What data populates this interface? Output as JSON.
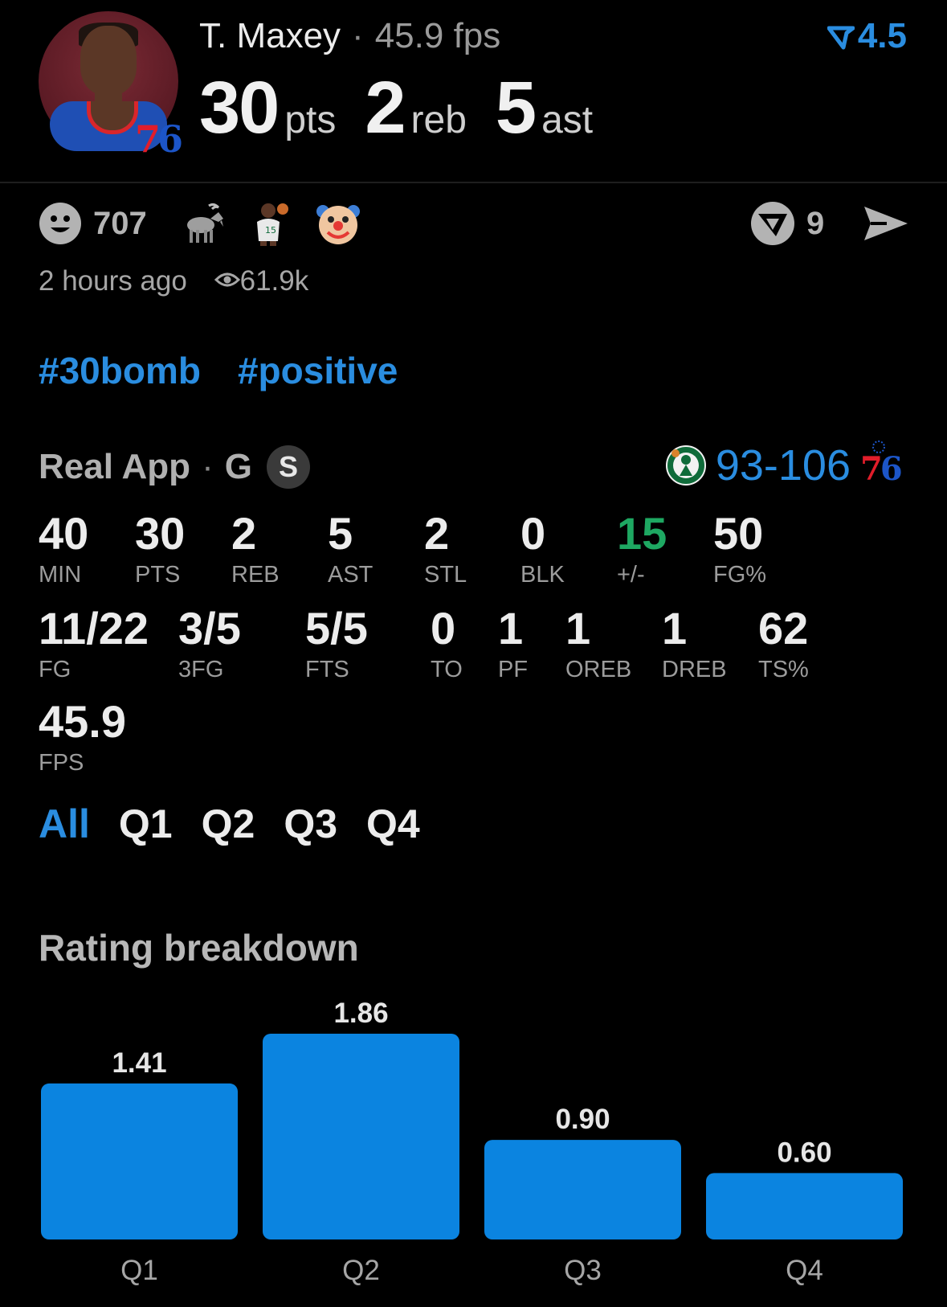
{
  "header": {
    "player_name": "T. Maxey",
    "fps_text": "45.9 fps",
    "line_value": "4.5",
    "team_logo_text": "76",
    "pts_value": "30",
    "pts_unit": "pts",
    "reb_value": "2",
    "reb_unit": "reb",
    "ast_value": "5",
    "ast_unit": "ast"
  },
  "reactions": {
    "smile_count": "707",
    "emojis": [
      "goat-emoji",
      "player-emoji",
      "clown-emoji"
    ],
    "tokens_count": "9",
    "time_ago": "2 hours ago",
    "views": "61.9k"
  },
  "tags": [
    "#30bomb",
    "#positive"
  ],
  "game": {
    "app": "Real App",
    "position": "G",
    "badge": "S",
    "score": "93-106",
    "home_logo_text": "76"
  },
  "stats": {
    "row1": [
      {
        "value": "40",
        "label": "MIN"
      },
      {
        "value": "30",
        "label": "PTS"
      },
      {
        "value": "2",
        "label": "REB"
      },
      {
        "value": "5",
        "label": "AST"
      },
      {
        "value": "2",
        "label": "STL"
      },
      {
        "value": "0",
        "label": "BLK"
      },
      {
        "value": "15",
        "label": "+/-"
      },
      {
        "value": "50",
        "label": "FG%"
      }
    ],
    "row2": [
      {
        "value": "11/22",
        "label": "FG"
      },
      {
        "value": "3/5",
        "label": "3FG"
      },
      {
        "value": "5/5",
        "label": "FTS"
      },
      {
        "value": "0",
        "label": "TO"
      },
      {
        "value": "1",
        "label": "PF"
      },
      {
        "value": "1",
        "label": "OREB"
      },
      {
        "value": "1",
        "label": "DREB"
      },
      {
        "value": "62",
        "label": "TS%"
      }
    ],
    "row3": [
      {
        "value": "45.9",
        "label": "FPS"
      }
    ]
  },
  "tabs": [
    "All",
    "Q1",
    "Q2",
    "Q3",
    "Q4"
  ],
  "rating": {
    "title": "Rating breakdown"
  },
  "chart_data": {
    "type": "bar",
    "categories": [
      "Q1",
      "Q2",
      "Q3",
      "Q4"
    ],
    "values": [
      1.41,
      1.86,
      0.9,
      0.6
    ],
    "value_labels": [
      "1.41",
      "1.86",
      "0.90",
      "0.60"
    ],
    "title": "",
    "xlabel": "",
    "ylabel": "",
    "ylim": [
      0,
      1.86
    ],
    "color": "#0b84e0"
  },
  "colors": {
    "accent": "#2a8de0",
    "positive": "#1ea862",
    "background": "#000000"
  }
}
